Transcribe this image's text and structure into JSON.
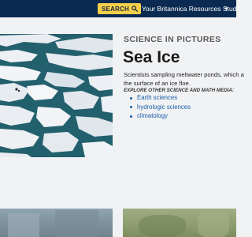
{
  "header": {
    "search_label": "SEARCH",
    "search_icon": "search-icon",
    "resources_label": "Your Britannica Resources",
    "resources_icon": "caret-down-icon",
    "study_label": "Stud"
  },
  "article": {
    "kicker": "SCIENCE IN PICTURES",
    "title": "Sea Ice",
    "caption_line1": "Scientists sampling meltwater ponds, which a",
    "caption_line2": "the surface of an ice floe.",
    "explore_label": "EXPLORE OTHER SCIENCE AND MATH MEDIA:",
    "links": [
      "Earth sciences",
      "hydrologic sciences",
      "climatology"
    ]
  },
  "colors": {
    "topbar": "#0a2a51",
    "search_button": "#f6cf4a",
    "link": "#1a5ea8",
    "page_bg": "#f1f2f4"
  }
}
